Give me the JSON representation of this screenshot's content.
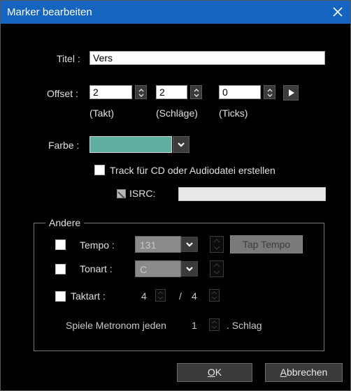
{
  "window": {
    "title": "Marker bearbeiten"
  },
  "titel": {
    "label": "Titel :",
    "value": "Vers"
  },
  "offset": {
    "label": "Offset :",
    "takt_value": "2",
    "schlaege_value": "2",
    "ticks_value": "0",
    "takt_caption": "(Takt)",
    "schlaege_caption": "(Schläge)",
    "ticks_caption": "(Ticks)"
  },
  "farbe": {
    "label": "Farbe :",
    "color": "#5fb0a0"
  },
  "cd_track": {
    "label": "Track für CD oder Audiodatei erstellen",
    "checked": false
  },
  "isrc": {
    "label": "ISRC:",
    "value": ""
  },
  "andere": {
    "title": "Andere",
    "tempo": {
      "label": "Tempo :",
      "value": "131",
      "checked": false,
      "tap_label": "Tap Tempo"
    },
    "tonart": {
      "label": "Tonart :",
      "value": "C",
      "checked": false
    },
    "taktart": {
      "label": "Taktart :",
      "numerator": "4",
      "separator": "/",
      "denominator": "4",
      "checked": false
    },
    "metronom": {
      "prefix": "Spiele Metronom jeden",
      "value": "1",
      "suffix": ". Schlag"
    }
  },
  "buttons": {
    "ok_accel": "O",
    "ok_rest": "K",
    "cancel_accel": "A",
    "cancel_rest": "bbrechen"
  },
  "colors": {
    "titlebar": "#1565c0",
    "background": "#000000"
  }
}
